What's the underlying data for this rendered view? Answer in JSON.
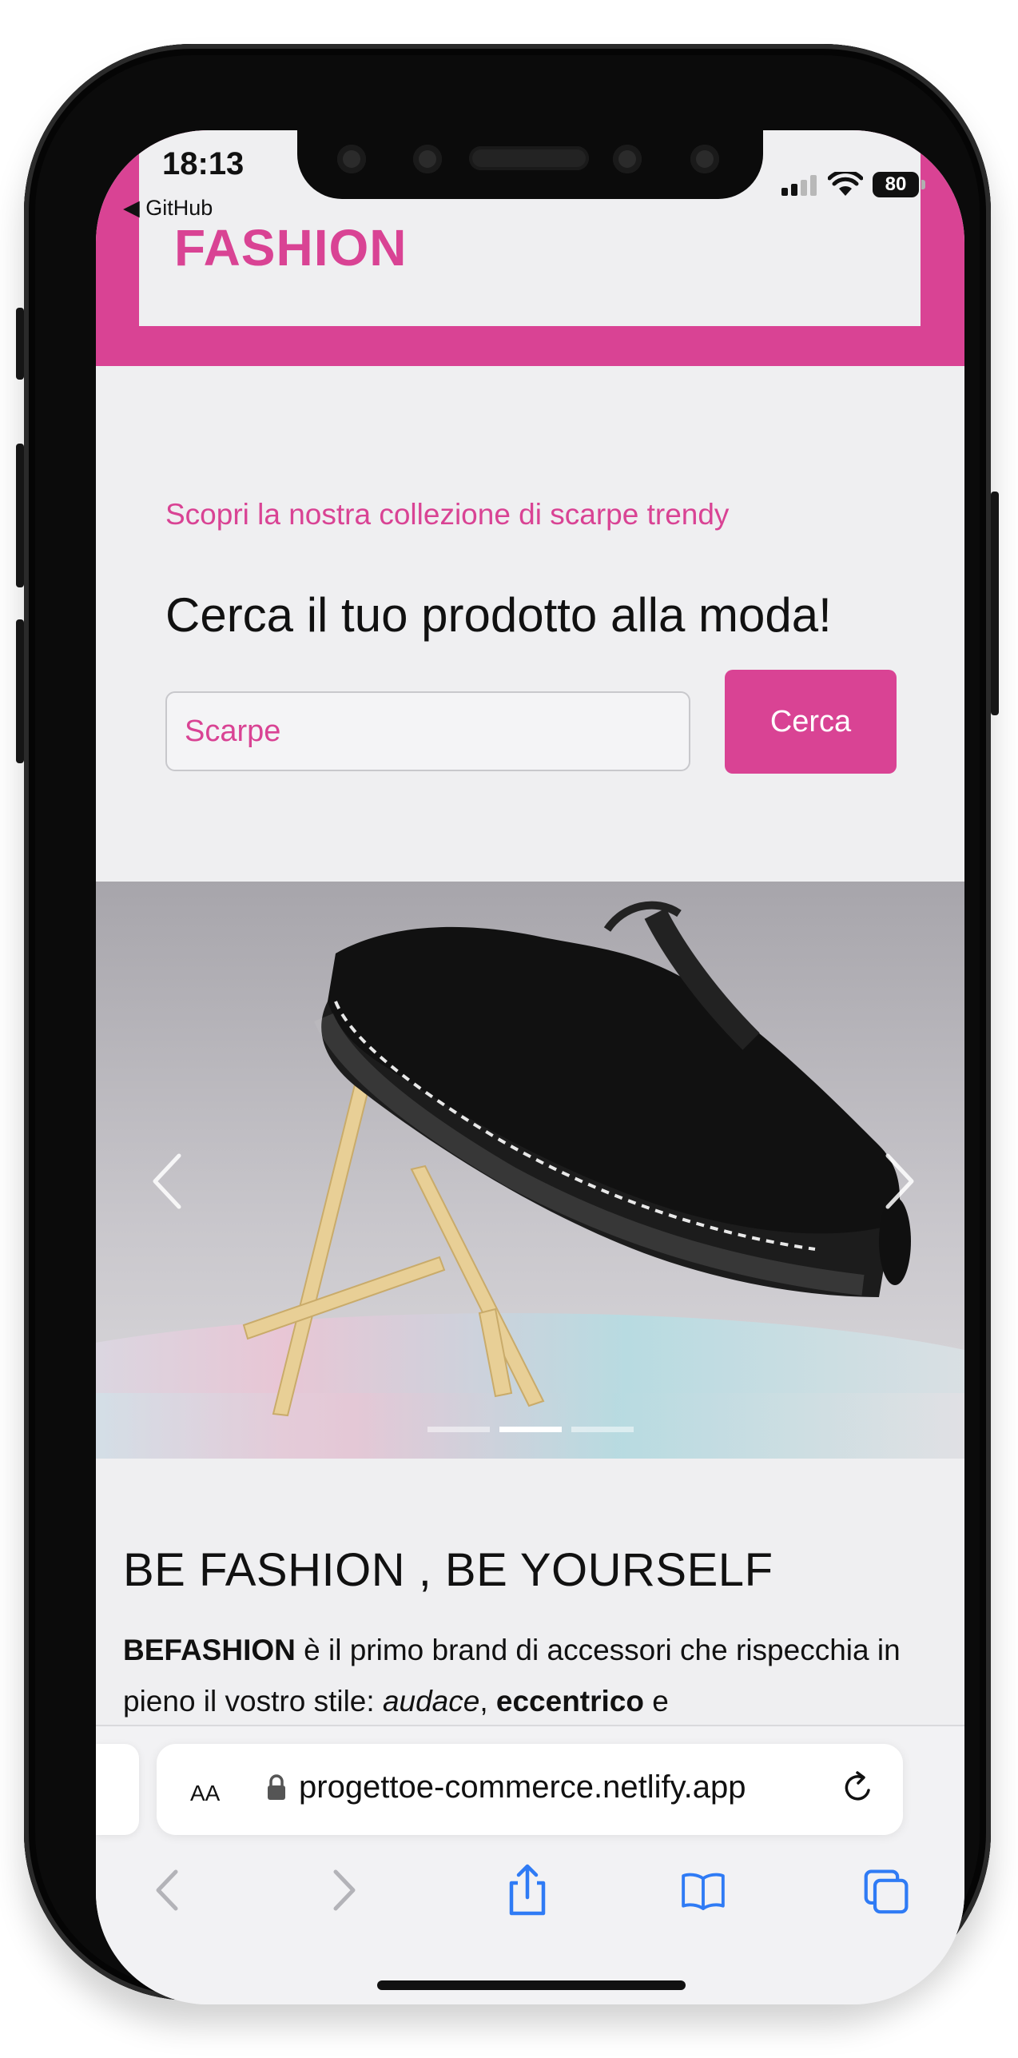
{
  "status_bar": {
    "time": "18:13",
    "back_app": "◀ GitHub",
    "battery": "80"
  },
  "site": {
    "brand": "FASHION",
    "subtitle": "Scopri la nostra collezione di scarpe trendy",
    "heading": "Cerca il tuo prodotto alla moda!",
    "search": {
      "value": "Scarpe",
      "button_label": "Cerca"
    },
    "carousel": {
      "slide_count": 3,
      "active_slide": 2,
      "image": "black suede shoe with 'Live · Love · Dream' sole tape on a wooden easel"
    },
    "about": {
      "title": "BE FASHION , BE YOURSELF",
      "brand_bold": "BEFASHION",
      "text_1": " è il primo brand di accessori che rispecchia in pieno il vostro stile: ",
      "italic": "audace",
      "comma": ", ",
      "bold_2": "eccentrico",
      "text_2": " e"
    }
  },
  "browser": {
    "text_size_label": "AA",
    "url": "progettoe-commerce.netlify.app",
    "icons": [
      "lock-icon",
      "reload-icon",
      "back-icon",
      "forward-icon",
      "share-icon",
      "bookmarks-icon",
      "tabs-icon"
    ]
  },
  "colors": {
    "accent": "#d94394",
    "screen_bg": "#efeff1",
    "toolbar_blue": "#2f7bf5"
  }
}
